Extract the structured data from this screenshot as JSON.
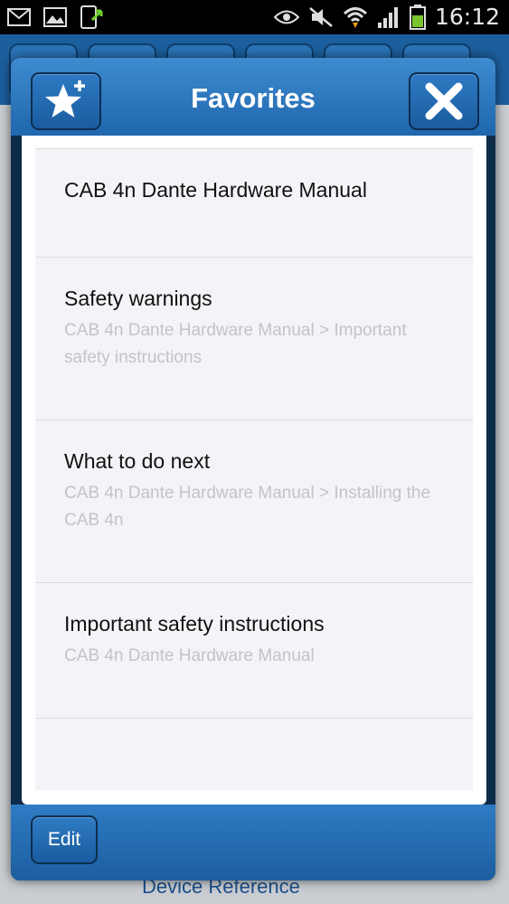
{
  "status_bar": {
    "time": "16:12",
    "icons": [
      "email-icon",
      "image-icon",
      "phone-sync-icon",
      "eye-icon",
      "mute-icon",
      "wifi-icon",
      "signal-icon",
      "battery-icon"
    ]
  },
  "background": {
    "bottom_link": "Device Reference"
  },
  "dialog": {
    "title": "Favorites",
    "add_favorite_icon": "star-plus-icon",
    "close_icon": "close-icon",
    "items": [
      {
        "title": "CAB 4n Dante Hardware Manual",
        "path": ""
      },
      {
        "title": "Safety warnings",
        "path": "CAB 4n Dante Hardware Manual > Important safety instructions"
      },
      {
        "title": "What to do next",
        "path": "CAB 4n Dante Hardware Manual > Installing the CAB 4n"
      },
      {
        "title": "Important safety instructions",
        "path": "CAB 4n Dante Hardware Manual"
      }
    ],
    "edit_label": "Edit"
  },
  "colors": {
    "header_blue": "#2b77c0",
    "dialog_border": "#0d2c4a",
    "list_bg": "#f4f3f7",
    "path_text": "#c4c4c8"
  }
}
